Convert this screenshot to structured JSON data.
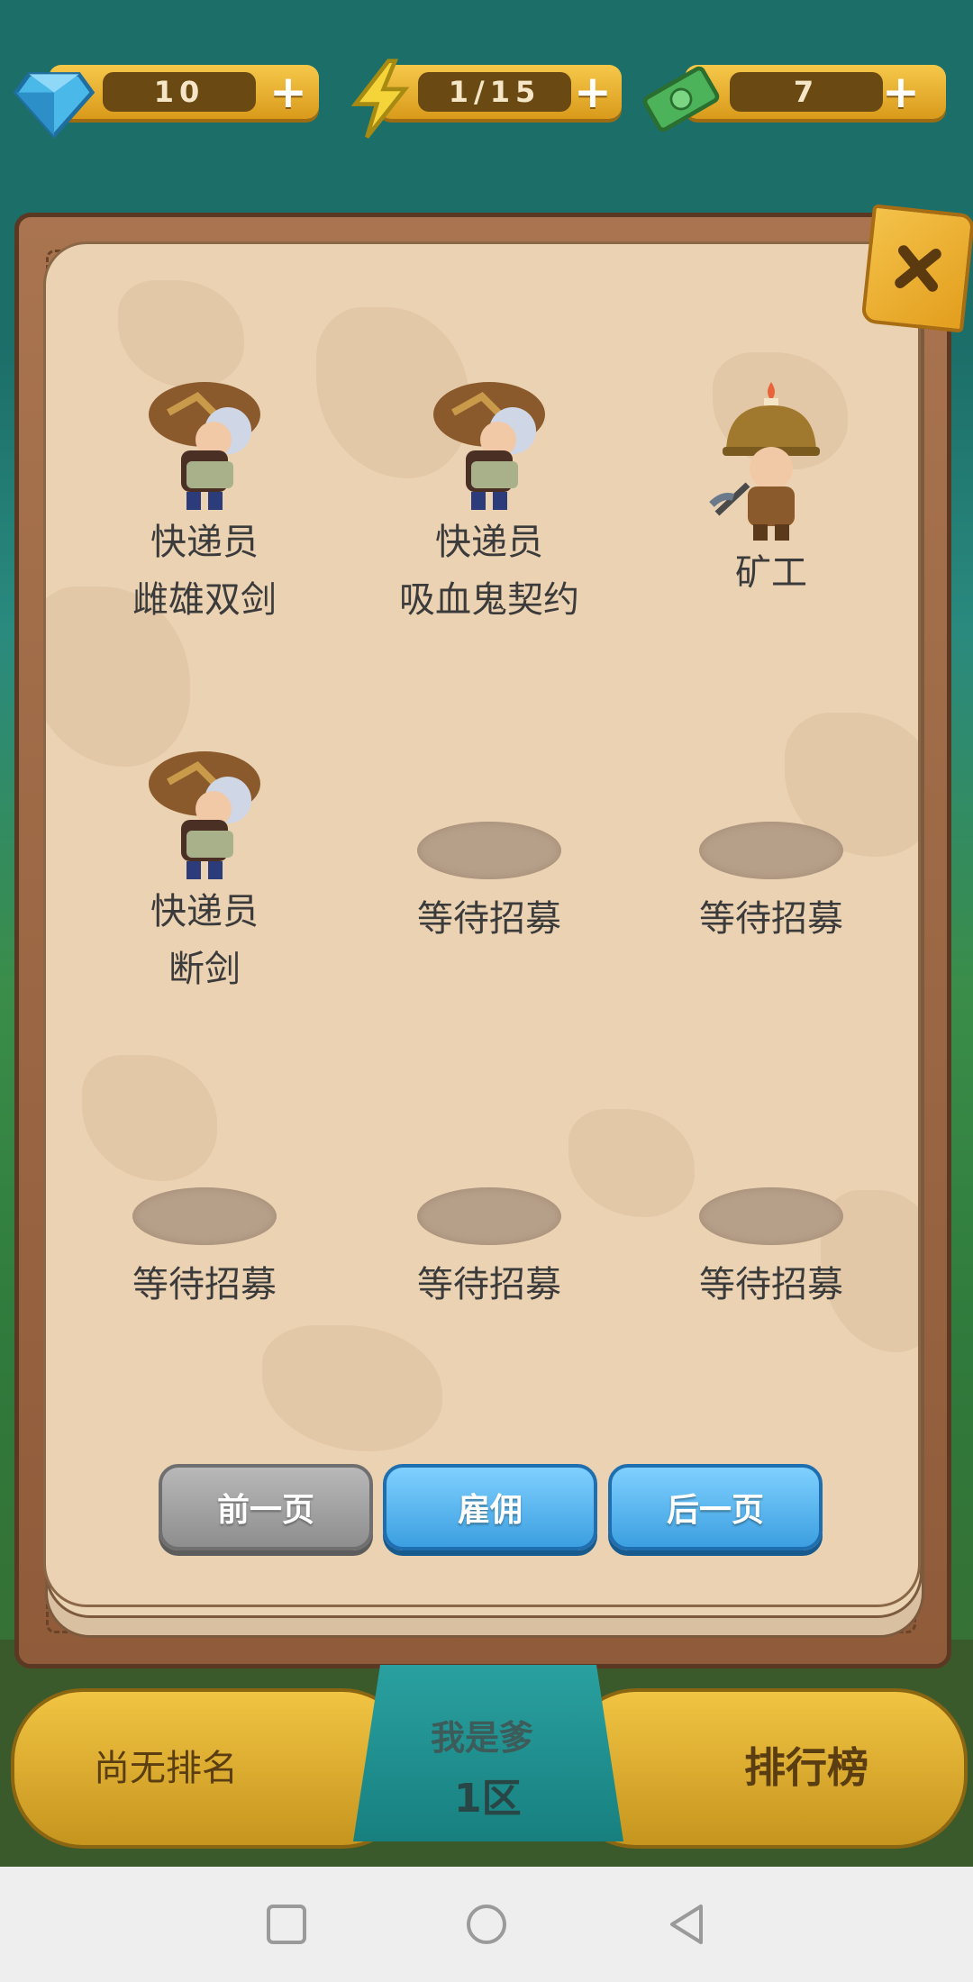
{
  "resources": {
    "gems": {
      "value": "10",
      "icon": "diamond-icon"
    },
    "energy": {
      "value": "1/15",
      "icon": "lightning-icon"
    },
    "cash": {
      "value": "7",
      "icon": "cash-icon"
    },
    "plus": "+"
  },
  "roster": {
    "slots": [
      {
        "kind": "courier",
        "name": "快递员",
        "item": "雌雄双剑"
      },
      {
        "kind": "courier",
        "name": "快递员",
        "item": "吸血鬼契约"
      },
      {
        "kind": "miner",
        "name": "矿工",
        "item": ""
      },
      {
        "kind": "courier",
        "name": "快递员",
        "item": "断剑"
      },
      {
        "kind": "empty",
        "name": "等待招募",
        "item": ""
      },
      {
        "kind": "empty",
        "name": "等待招募",
        "item": ""
      },
      {
        "kind": "empty",
        "name": "等待招募",
        "item": ""
      },
      {
        "kind": "empty",
        "name": "等待招募",
        "item": ""
      },
      {
        "kind": "empty",
        "name": "等待招募",
        "item": ""
      }
    ]
  },
  "buttons": {
    "prev": "前一页",
    "hire": "雇佣",
    "next": "后一页"
  },
  "banner": {
    "rank_status": "尚无排名",
    "player_name": "我是爹",
    "server": "1区",
    "leaderboard": "排行榜"
  },
  "colors": {
    "accent_blue": "#3c9fe0",
    "gold": "#f1c443",
    "paper": "#ebd2b2"
  }
}
